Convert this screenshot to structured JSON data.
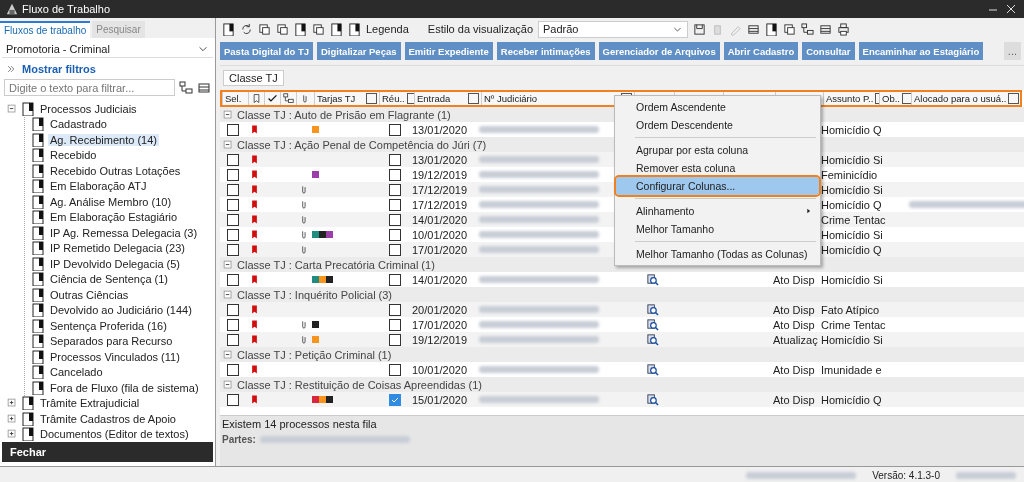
{
  "window": {
    "title": "Fluxo de Trabalho"
  },
  "sidebar": {
    "tabs": [
      {
        "label": "Fluxos de trabalho",
        "selected": true
      },
      {
        "label": "Pesquisar",
        "selected": false
      }
    ],
    "queue_select": {
      "value": "Promotoria - Criminal"
    },
    "filters_link": "Mostrar filtros",
    "filter_field": {
      "placeholder": "Digite o texto para filtrar..."
    },
    "tree": [
      {
        "label": "Processos Judiciais",
        "expanded": true,
        "selected": false,
        "children": [
          {
            "label": "Cadastrado",
            "selected": false
          },
          {
            "label": "Ag. Recebimento (14)",
            "selected": true
          },
          {
            "label": "Recebido",
            "selected": false
          },
          {
            "label": "Recebido Outras Lotações",
            "selected": false
          },
          {
            "label": "Em Elaboração ATJ",
            "selected": false
          },
          {
            "label": "Ag. Análise Membro (10)",
            "selected": false
          },
          {
            "label": "Em Elaboração Estagiário",
            "selected": false
          },
          {
            "label": "IP Ag. Remessa Delegacia (3)",
            "selected": false
          },
          {
            "label": "IP Remetido Delegacia (23)",
            "selected": false
          },
          {
            "label": "IP Devolvido Delegacia (5)",
            "selected": false
          },
          {
            "label": "Ciência de Sentença (1)",
            "selected": false
          },
          {
            "label": "Outras Ciências",
            "selected": false
          },
          {
            "label": "Devolvido ao Judiciário (144)",
            "selected": false
          },
          {
            "label": "Sentença Proferida (16)",
            "selected": false
          },
          {
            "label": "Separados para Recurso",
            "selected": false
          },
          {
            "label": "Processos Vinculados (11)",
            "selected": false
          },
          {
            "label": "Cancelado",
            "selected": false
          },
          {
            "label": "Fora de Fluxo (fila de sistema)",
            "selected": false
          }
        ]
      },
      {
        "label": "Trâmite Extrajudicial",
        "expanded": false,
        "selected": false
      },
      {
        "label": "Trâmite Cadastros de Apoio",
        "expanded": false,
        "selected": false
      },
      {
        "label": "Documentos (Editor de textos)",
        "expanded": false,
        "selected": false
      }
    ],
    "close_button": "Fechar"
  },
  "toolbar": {
    "legend": "Legenda",
    "view_style_label": "Estilo da visualização",
    "view_style": {
      "value": "Padrão"
    }
  },
  "actions": [
    "Pasta Digital do TJ",
    "Digitalizar Peças",
    "Emitir Expediente",
    "Receber intimações",
    "Gerenciador de Arquivos",
    "Abrir Cadastro",
    "Consultar",
    "Encaminhar ao Estagiário"
  ],
  "more_button": "...",
  "group_by": [
    "Classe TJ"
  ],
  "table": {
    "columns": [
      {
        "kind": "text",
        "label": "Sel."
      },
      {
        "kind": "icon"
      },
      {
        "kind": "icon"
      },
      {
        "kind": "icon"
      },
      {
        "kind": "icon"
      },
      {
        "kind": "text",
        "label": "Tarjas TJ",
        "filter": true
      },
      {
        "kind": "text",
        "label": "Réu..",
        "filter": true
      },
      {
        "kind": "text",
        "label": "Entrada",
        "filter": true
      },
      {
        "kind": "text",
        "label": "Nº Judiciário",
        "filter": true
      },
      {
        "kind": "covered"
      },
      {
        "kind": "covered"
      },
      {
        "kind": "covered"
      },
      {
        "kind": "covered"
      },
      {
        "kind": "text",
        "label": "Assunto P..",
        "filter": true
      },
      {
        "kind": "text",
        "label": "Ob..",
        "filter": true
      },
      {
        "kind": "text",
        "label": "Alocado para o usuá..",
        "filter": true
      }
    ],
    "groups": [
      {
        "label": "Classe TJ : Auto de Prisão em Flagrante",
        "count": "(1)",
        "expanded": true,
        "rows": [
          {
            "checked": false,
            "flagged": true,
            "attachment": false,
            "tags": [
              {
                "color": "#f7941d"
              }
            ],
            "defendant_checked": false,
            "entry": "13/01/2020",
            "subject": "Homicídio Q"
          }
        ]
      },
      {
        "label": "Classe TJ : Ação Penal de Competência do Júri",
        "count": "(7)",
        "expanded": true,
        "rows": [
          {
            "checked": false,
            "flagged": true,
            "attachment": false,
            "tags": [],
            "defendant_checked": false,
            "entry": "13/01/2020",
            "subject": "Homicídio Si"
          },
          {
            "checked": false,
            "flagged": true,
            "attachment": false,
            "tags": [
              {
                "color": "#9b3fa8"
              }
            ],
            "defendant_checked": false,
            "entry": "19/12/2019",
            "subject": "Feminicídio"
          },
          {
            "checked": false,
            "flagged": true,
            "attachment": true,
            "tags": [],
            "defendant_checked": false,
            "entry": "17/12/2019",
            "subject": "Homicídio Si"
          },
          {
            "checked": false,
            "flagged": true,
            "attachment": true,
            "tags": [],
            "defendant_checked": false,
            "entry": "17/12/2019",
            "subject": "Homicídio Q",
            "allocated_redacted": true
          },
          {
            "checked": false,
            "flagged": true,
            "attachment": true,
            "tags": [],
            "defendant_checked": false,
            "entry": "14/01/2020",
            "subject": "Crime Tentac"
          },
          {
            "checked": false,
            "flagged": true,
            "attachment": true,
            "tags": [
              {
                "color": "#1f8c7f"
              },
              {
                "color": "#222222"
              },
              {
                "color": "#9b3fa8"
              }
            ],
            "defendant_checked": false,
            "entry": "10/01/2020",
            "subject": "Homicídio Si"
          },
          {
            "checked": false,
            "flagged": true,
            "attachment": true,
            "tags": [],
            "defendant_checked": false,
            "entry": "17/01/2020",
            "subject": "Homicídio Q"
          }
        ]
      },
      {
        "label": "Classe TJ : Carta Precatória Criminal",
        "count": "(1)",
        "expanded": true,
        "rows": [
          {
            "checked": false,
            "flagged": true,
            "attachment": false,
            "tags": [
              {
                "color": "#1f8c7f"
              },
              {
                "color": "#f7941d"
              },
              {
                "color": "#222222"
              }
            ],
            "defendant_checked": false,
            "entry": "14/01/2020",
            "search": true,
            "last": "Ato Disp",
            "subject": "Homicídio Si"
          }
        ]
      },
      {
        "label": "Classe TJ : Inquérito Policial",
        "count": "(3)",
        "expanded": true,
        "rows": [
          {
            "checked": false,
            "flagged": true,
            "attachment": false,
            "tags": [],
            "defendant_checked": false,
            "entry": "20/01/2020",
            "search": true,
            "last": "Ato Disp",
            "subject": "Fato Atípico"
          },
          {
            "checked": false,
            "flagged": true,
            "attachment": true,
            "tags": [
              {
                "color": "#222222"
              }
            ],
            "defendant_checked": false,
            "entry": "17/01/2020",
            "search": true,
            "last": "Ato Disp",
            "subject": "Crime Tentac"
          },
          {
            "checked": false,
            "flagged": true,
            "attachment": true,
            "tags": [
              {
                "color": "#f7941d"
              }
            ],
            "defendant_checked": false,
            "entry": "19/12/2019",
            "search": true,
            "last": "Atualizaç",
            "subject": "Homicídio Si"
          }
        ]
      },
      {
        "label": "Classe TJ : Petição Criminal",
        "count": "(1)",
        "expanded": true,
        "rows": [
          {
            "checked": false,
            "flagged": true,
            "attachment": false,
            "tags": [],
            "defendant_checked": false,
            "entry": "10/01/2020",
            "search": true,
            "last": "Ato Disp",
            "subject": "Imunidade e"
          }
        ]
      },
      {
        "label": "Classe TJ : Restituição de Coisas Apreendidas",
        "count": "(1)",
        "expanded": true,
        "rows": [
          {
            "checked": false,
            "flagged": true,
            "attachment": false,
            "tags": [
              {
                "color": "#d7263d"
              },
              {
                "color": "#f7941d"
              },
              {
                "color": "#222222"
              }
            ],
            "defendant_checked": true,
            "entry": "15/01/2020",
            "search": true,
            "last": "Ato Disp",
            "subject": "Homicídio Q"
          }
        ]
      }
    ]
  },
  "footer": {
    "count_text": "Existem 14 processos nesta fila",
    "parties_label": "Partes:"
  },
  "status_bar": {
    "version": "Versão: 4.1.3-0"
  },
  "context_menu": [
    {
      "kind": "item",
      "label": "Ordem Ascendente",
      "selected": false
    },
    {
      "kind": "item",
      "label": "Ordem Descendente",
      "selected": false
    },
    {
      "kind": "separator"
    },
    {
      "kind": "item",
      "label": "Agrupar por esta coluna",
      "selected": false
    },
    {
      "kind": "item",
      "label": "Remover esta coluna",
      "selected": false
    },
    {
      "kind": "item",
      "label": "Configurar Colunas...",
      "selected": true
    },
    {
      "kind": "separator"
    },
    {
      "kind": "submenu",
      "label": "Alinhamento",
      "selected": false
    },
    {
      "kind": "item",
      "label": "Melhor Tamanho",
      "selected": false
    },
    {
      "kind": "separator"
    },
    {
      "kind": "item",
      "label": "Melhor Tamanho (Todas as Colunas)",
      "selected": false
    }
  ]
}
